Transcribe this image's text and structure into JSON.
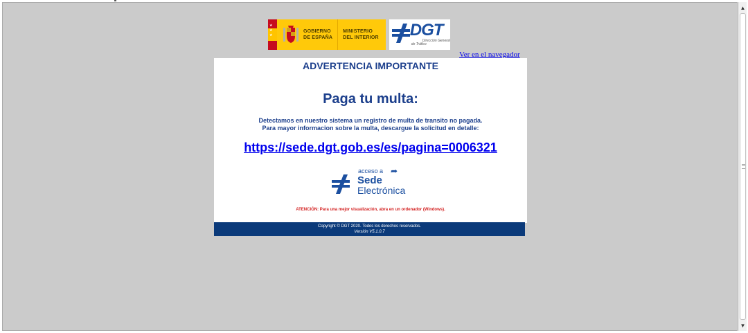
{
  "logos": {
    "gov_line1": "GOBIERNO",
    "gov_line2": "DE ESPAÑA",
    "ministry_line1": "MINISTERIO",
    "ministry_line2": "DEL INTERIOR",
    "dgt_word": "DGT",
    "dgt_sub1": "Dirección General",
    "dgt_sub2": "de Tráfico"
  },
  "view_in_browser": "Ver en el navegador",
  "card": {
    "heading": "ADVERTENCIA IMPORTANTE",
    "headline": "Paga tu multa:",
    "message_line1": "Detectamos en nuestro sistema un registro de multa de transito no pagada.",
    "message_line2": "Para mayor informacion sobre la multa, descargue la solicitud en detalle:",
    "link_url": "https://sede.dgt.gob.es/es/pagina=0006321",
    "sede_access": "acceso a",
    "sede_word": "Sede",
    "sede_word2": "Electrónica",
    "warning": "ATENCIÓN: Para una mejor visualización, abra en un ordenador (Windows)."
  },
  "footer": {
    "copyright": "Copyright © DGT 2020. Todos los derechos reservados.",
    "version": "Versión V5.1.0.7"
  },
  "colors": {
    "background": "#cbcbcb",
    "brand_blue": "#1c3f8c",
    "footer_blue": "#0b3a7a",
    "warning_red": "#d32020",
    "gov_yellow": "#ffc90a"
  },
  "icons": [
    "spain-flag-icon",
    "coat-of-arms-icon",
    "dgt-logo-icon",
    "sede-electronica-icon",
    "arrow-up-icon",
    "arrow-down-icon"
  ]
}
